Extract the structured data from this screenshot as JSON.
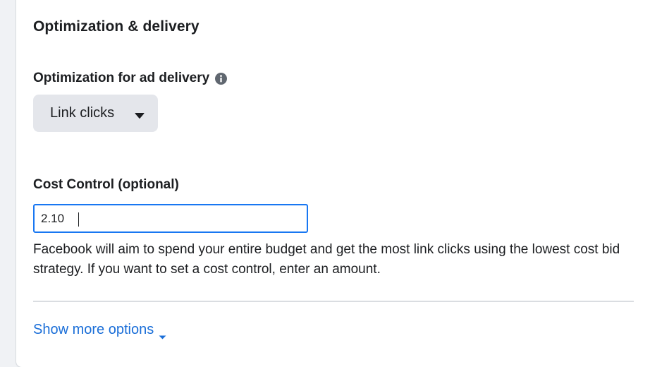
{
  "section": {
    "title": "Optimization & delivery"
  },
  "optimization": {
    "label": "Optimization for ad delivery",
    "info_icon": "info-icon",
    "selected_value": "Link clicks",
    "dropdown_icon": "caret-down-icon"
  },
  "cost_control": {
    "label": "Cost Control (optional)",
    "value": "2.10",
    "help_text": "Facebook will aim to spend your entire budget and get the most link clicks using the lowest cost bid strategy. If you want to set a cost control, enter an amount."
  },
  "footer": {
    "show_more_label": "Show more options",
    "show_more_icon": "chevron-down-icon"
  },
  "colors": {
    "accent": "#1877f2",
    "link": "#1a6ed8",
    "dropdown_bg": "#e4e6eb",
    "text": "#1c1e21",
    "divider": "#dadde1"
  }
}
